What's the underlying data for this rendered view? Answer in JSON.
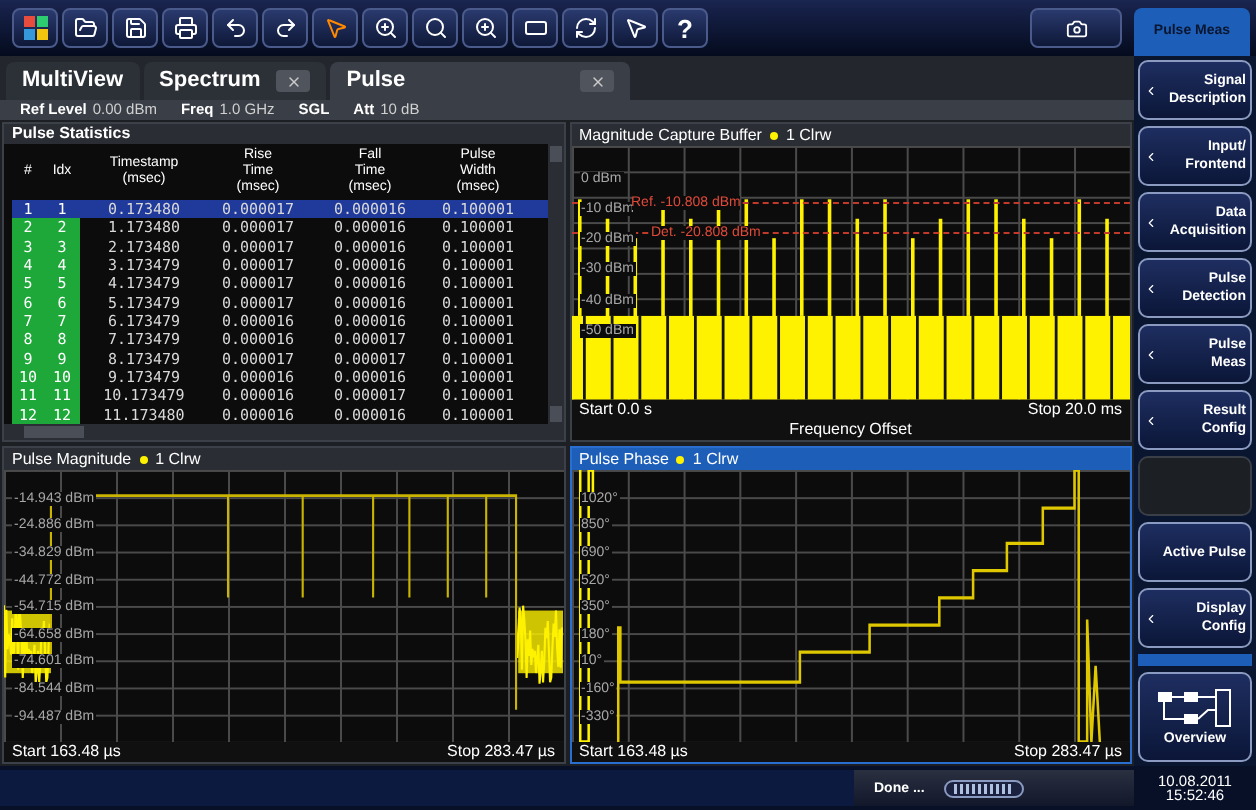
{
  "toolbar": {
    "buttons": [
      {
        "kind": "windows"
      },
      {
        "kind": "open"
      },
      {
        "kind": "save"
      },
      {
        "kind": "print"
      },
      {
        "kind": "undo"
      },
      {
        "kind": "redo"
      },
      {
        "kind": "pointer"
      },
      {
        "kind": "zoom"
      },
      {
        "kind": "multizoom"
      },
      {
        "kind": "zoom11"
      },
      {
        "kind": "window"
      },
      {
        "kind": "sequence"
      },
      {
        "kind": "help-pointer"
      },
      {
        "kind": "text",
        "label": "?"
      }
    ],
    "right_button": {
      "kind": "camera"
    }
  },
  "softkey_title": "Pulse Meas",
  "tabs": [
    {
      "label": "MultiView",
      "selected": false,
      "closable": false
    },
    {
      "label": "Spectrum",
      "selected": false,
      "closable": true
    },
    {
      "label": "Pulse",
      "selected": true,
      "closable": true
    }
  ],
  "info_bar": [
    {
      "label": "Ref Level",
      "value": "0.00 dBm"
    },
    {
      "label": "Freq",
      "value": "1.0 GHz"
    },
    {
      "label": "SGL"
    },
    {
      "label": "Att",
      "value": "10 dB"
    }
  ],
  "pulse_statistics": {
    "title": "Pulse Statistics",
    "columns": [
      "#",
      "Idx",
      "Timestamp\n(msec)",
      "Rise\nTime\n(msec)",
      "Fall\nTime\n(msec)",
      "Pulse\nWidth\n(msec)"
    ],
    "rows": [
      {
        "selected": true,
        "cells": [
          "1",
          "1",
          "0.173480",
          "0.000017",
          "0.000016",
          "0.100001"
        ]
      },
      {
        "selected": false,
        "cells": [
          "2",
          "2",
          "1.173480",
          "0.000017",
          "0.000016",
          "0.100001"
        ]
      },
      {
        "selected": false,
        "cells": [
          "3",
          "3",
          "2.173480",
          "0.000017",
          "0.000016",
          "0.100001"
        ]
      },
      {
        "selected": false,
        "cells": [
          "4",
          "4",
          "3.173479",
          "0.000017",
          "0.000016",
          "0.100001"
        ]
      },
      {
        "selected": false,
        "cells": [
          "5",
          "5",
          "4.173479",
          "0.000017",
          "0.000016",
          "0.100001"
        ]
      },
      {
        "selected": false,
        "cells": [
          "6",
          "6",
          "5.173479",
          "0.000017",
          "0.000016",
          "0.100001"
        ]
      },
      {
        "selected": false,
        "cells": [
          "7",
          "7",
          "6.173479",
          "0.000016",
          "0.000016",
          "0.100001"
        ]
      },
      {
        "selected": false,
        "cells": [
          "8",
          "8",
          "7.173479",
          "0.000016",
          "0.000017",
          "0.100001"
        ]
      },
      {
        "selected": false,
        "cells": [
          "9",
          "9",
          "8.173479",
          "0.000017",
          "0.000017",
          "0.100001"
        ]
      },
      {
        "selected": false,
        "cells": [
          "10",
          "10",
          "9.173479",
          "0.000016",
          "0.000016",
          "0.100001"
        ]
      },
      {
        "selected": false,
        "cells": [
          "11",
          "11",
          "10.173479",
          "0.000016",
          "0.000017",
          "0.100001"
        ]
      },
      {
        "selected": false,
        "cells": [
          "12",
          "12",
          "11.173480",
          "0.000016",
          "0.000016",
          "0.100001"
        ]
      }
    ]
  },
  "panels": [
    {
      "kind": "capture",
      "title": "Magnitude Capture Buffer",
      "trace": "1 Clrw",
      "active": false,
      "y_labels": [
        "0 dBm",
        "-10 dBm",
        "-20 dBm",
        "-30 dBm",
        "-40 dBm",
        "-50 dBm"
      ],
      "markers": [
        {
          "label": "Ref. -10.808 dBm"
        },
        {
          "label": "Det. -20.808 dBm"
        }
      ],
      "start": "Start 0.0 s",
      "stop": "Stop 20.0 ms",
      "x_title": "Frequency Offset"
    },
    {
      "kind": "magnitude",
      "title": "Pulse Magnitude",
      "trace": "1 Clrw",
      "active": false,
      "y_labels": [
        "-14.943 dBm",
        "-24.886 dBm",
        "-34.829 dBm",
        "-44.772 dBm",
        "-54.715 dBm",
        "-64.658 dBm",
        "-74.601 dBm",
        "-84.544 dBm",
        "-94.487 dBm"
      ],
      "start": "Start 163.48 µs",
      "stop": "Stop 283.47 µs"
    },
    {
      "kind": "phase",
      "title": "Pulse Phase",
      "trace": "1 Clrw",
      "active": true,
      "y_labels": [
        "1020°",
        "850°",
        "690°",
        "520°",
        "350°",
        "180°",
        "10°",
        "-160°",
        "-330°"
      ],
      "start": "Start 163.48 µs",
      "stop": "Stop 283.47 µs"
    }
  ],
  "softkeys": [
    {
      "kind": "menu",
      "label": "Signal\nDescription"
    },
    {
      "kind": "menu",
      "label": "Input/\nFrontend"
    },
    {
      "kind": "menu",
      "label": "Data\nAcquisition"
    },
    {
      "kind": "menu",
      "label": "Pulse\nDetection"
    },
    {
      "kind": "menu",
      "label": "Pulse\nMeas"
    },
    {
      "kind": "menu",
      "label": "Result\nConfig"
    },
    {
      "kind": "empty"
    },
    {
      "kind": "plain",
      "label": "Active Pulse"
    },
    {
      "kind": "menu",
      "label": "Display\nConfig"
    }
  ],
  "overview_button": "Overview",
  "status_bar": {
    "message": "Done ...",
    "date": "10.08.2011",
    "time": "15:52:46"
  }
}
